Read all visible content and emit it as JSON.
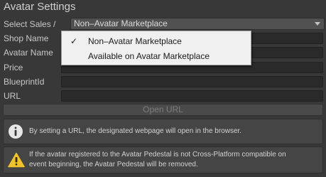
{
  "panel": {
    "title": "Avatar Settings"
  },
  "select_sales": {
    "label": "Select Sales /",
    "selected": "Non–Avatar Marketplace"
  },
  "dropdown_options": [
    {
      "label": "Non–Avatar Marketplace",
      "checked": true,
      "check_mark": "✓"
    },
    {
      "label": "Available on Avatar Marketplace",
      "checked": false,
      "check_mark": ""
    }
  ],
  "fields": [
    {
      "label": "Shop Name",
      "value": ""
    },
    {
      "label": "Avatar Name",
      "value": ""
    },
    {
      "label": "Price",
      "value": ""
    },
    {
      "label": "BlueprintId",
      "value": ""
    },
    {
      "label": "URL",
      "value": ""
    }
  ],
  "open_url_button": {
    "label": "Open URL",
    "enabled": false
  },
  "info_message": {
    "icon": "info-icon",
    "text": "By setting a URL, the designated webpage will open in the browser."
  },
  "warning_message": {
    "icon": "warning-icon",
    "line1": "If the avatar registered to the Avatar Pedestal is not Cross-Platform compatible on",
    "line2": "event beginning, the Avatar Pedestal will be removed."
  },
  "colors": {
    "background": "#383838",
    "field": "#2a2a2a",
    "popup": "#f0f0f0",
    "warning": "#f2c22b"
  }
}
